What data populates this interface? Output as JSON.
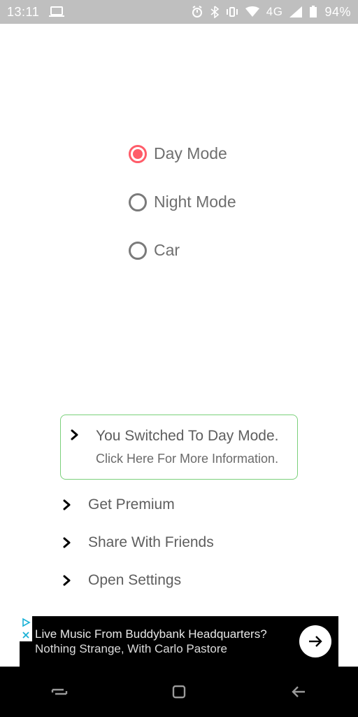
{
  "status_bar": {
    "time": "13:11",
    "battery": "94%",
    "network": "4G"
  },
  "modes": {
    "day": {
      "label": "Day Mode",
      "selected": true
    },
    "night": {
      "label": "Night Mode",
      "selected": false
    },
    "car": {
      "label": "Car",
      "selected": false
    }
  },
  "callout": {
    "title": "You Switched To Day Mode.",
    "subtitle": "Click Here For More Information."
  },
  "actions": {
    "premium": "Get Premium",
    "share": "Share With Friends",
    "settings": "Open Settings"
  },
  "ad": {
    "line1": "Live Music From Buddybank Headquarters?",
    "line2": "Nothing Strange, With Carlo Pastore"
  }
}
